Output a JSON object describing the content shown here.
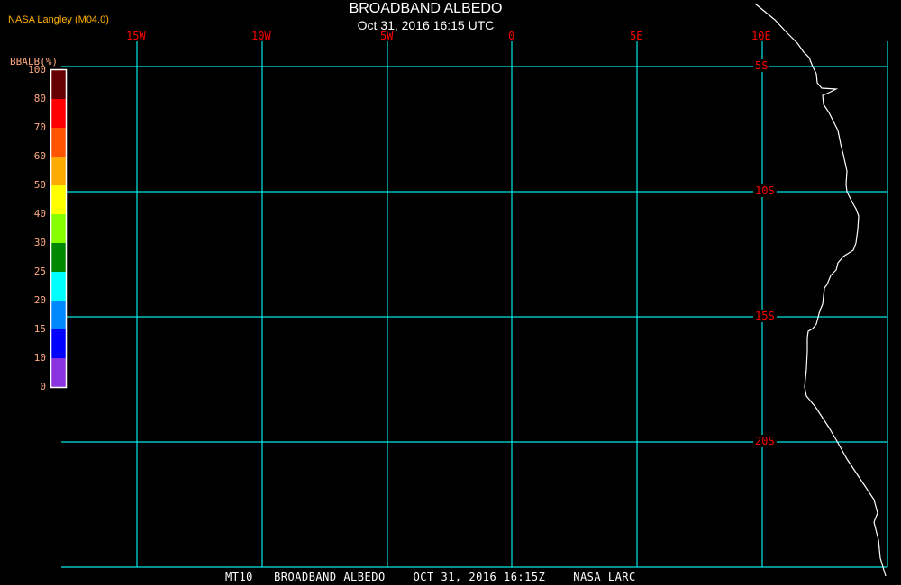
{
  "header": {
    "org": "NASA Langley (M04.0)",
    "title": "BROADBAND ALBEDO",
    "subtitle": "Oct 31, 2016 16:15 UTC"
  },
  "colorbar": {
    "title": "BBALB(%)",
    "labels": [
      "100",
      "80",
      "70",
      "60",
      "50",
      "40",
      "30",
      "25",
      "20",
      "15",
      "10",
      "0"
    ],
    "colors": [
      "#660000",
      "#ff0000",
      "#ff5500",
      "#ffaa00",
      "#ffff00",
      "#88ff00",
      "#008800",
      "#00ffff",
      "#0088ff",
      "#0000ff",
      "#8833dd"
    ]
  },
  "map": {
    "grid_color": "#00e5e5",
    "coastline_color": "#ffffff",
    "lon_labels": [
      "15W",
      "10W",
      "5W",
      "0",
      "5E",
      "10E"
    ],
    "lat_labels": [
      "5S",
      "10S",
      "15S",
      "20S"
    ]
  },
  "footer": "MT10   BROADBAND ALBEDO    OCT 31, 2016 16:15Z    NASA LARC"
}
